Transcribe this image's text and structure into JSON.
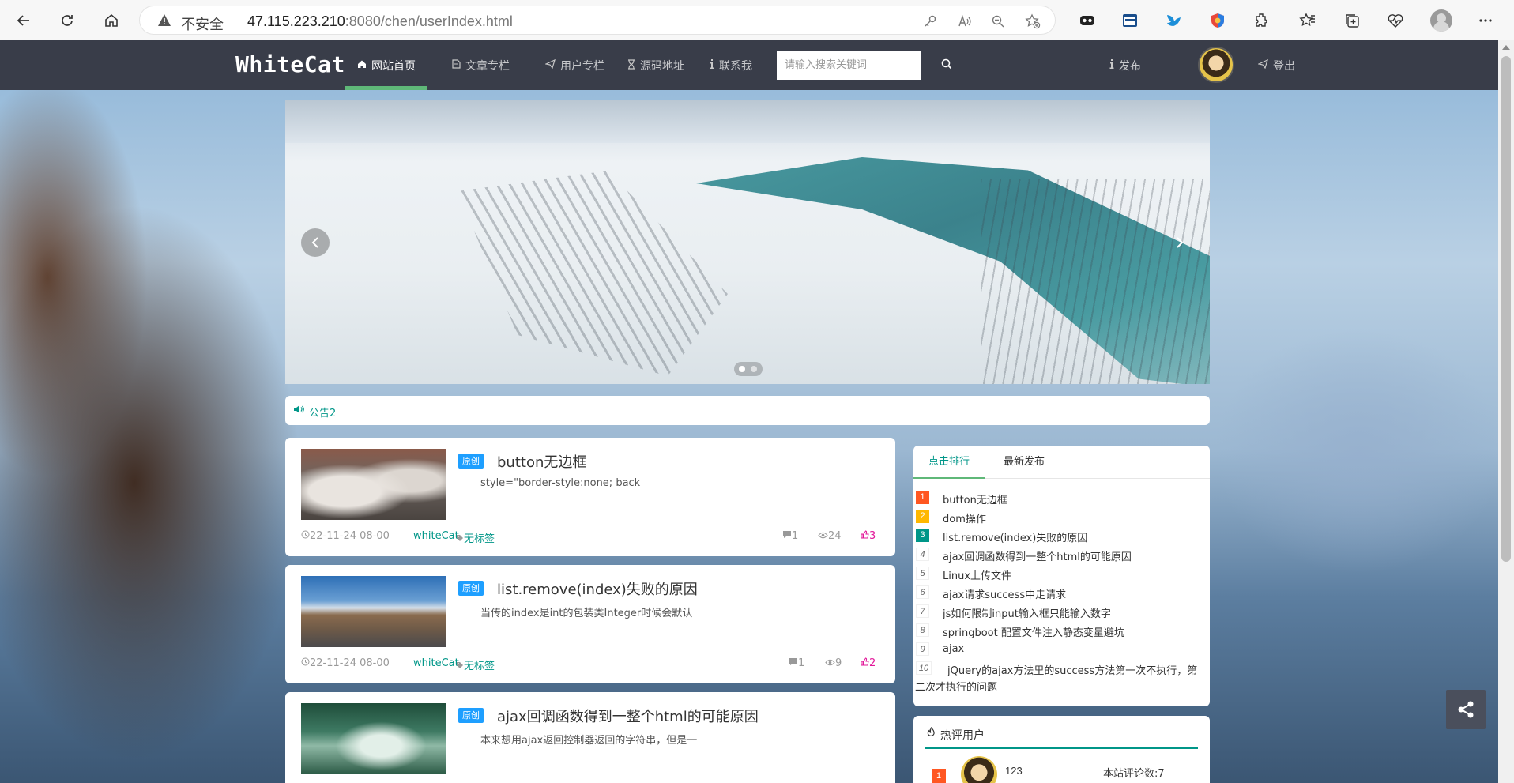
{
  "browser": {
    "insecure_label": "不安全",
    "url_host": "47.115.223.210",
    "url_rest": ":8080/chen/userIndex.html"
  },
  "nav": {
    "logo": "WhiteCat",
    "items": [
      {
        "label": "网站首页",
        "icon": "home-icon",
        "active": true
      },
      {
        "label": "文章专栏",
        "icon": "file-icon"
      },
      {
        "label": "用户专栏",
        "icon": "send-icon"
      },
      {
        "label": "源码地址",
        "icon": "hourglass-icon"
      },
      {
        "label": "联系我",
        "icon": "info-icon"
      }
    ],
    "search_placeholder": "请输入搜索关键词",
    "publish": "发布",
    "logout": "登出"
  },
  "notice": {
    "text": "公告2"
  },
  "articles": [
    {
      "badge": "原创",
      "title": "button无边框",
      "desc": "style=\"border-style:none; back",
      "date": "22-11-24 08-00",
      "author": "whiteCat",
      "tag": "无标签",
      "comments": "1",
      "views": "24",
      "likes": "3"
    },
    {
      "badge": "原创",
      "title": "list.remove(index)失败的原因",
      "desc": "当传的index是int的包装类Integer时候会默认",
      "date": "22-11-24 08-00",
      "author": "whiteCat",
      "tag": "无标签",
      "comments": "1",
      "views": "9",
      "likes": "2"
    },
    {
      "badge": "原创",
      "title": "ajax回调函数得到一整个html的可能原因",
      "desc": "本来想用ajax返回控制器返回的字符串，但是一"
    }
  ],
  "ranking": {
    "tabs": [
      "点击排行",
      "最新发布"
    ],
    "items": [
      {
        "n": "1",
        "title": "button无边框"
      },
      {
        "n": "2",
        "title": "dom操作"
      },
      {
        "n": "3",
        "title": "list.remove(index)失败的原因"
      },
      {
        "n": "4",
        "title": "ajax回调函数得到一整个html的可能原因"
      },
      {
        "n": "5",
        "title": "Linux上传文件"
      },
      {
        "n": "6",
        "title": "ajax请求success中走请求"
      },
      {
        "n": "7",
        "title": "js如何限制input输入框只能输入数字"
      },
      {
        "n": "8",
        "title": "springboot 配置文件注入静态变量避坑"
      },
      {
        "n": "9",
        "title": "ajax"
      },
      {
        "n": "10",
        "title_line1": "jQuery的ajax方法里的success方法第一次不执行，第",
        "title_line2": "二次才执行的问题"
      }
    ]
  },
  "hot_users": {
    "title": "热评用户",
    "users": [
      {
        "n": "1",
        "name": "123",
        "count": "本站评论数:7"
      }
    ]
  }
}
